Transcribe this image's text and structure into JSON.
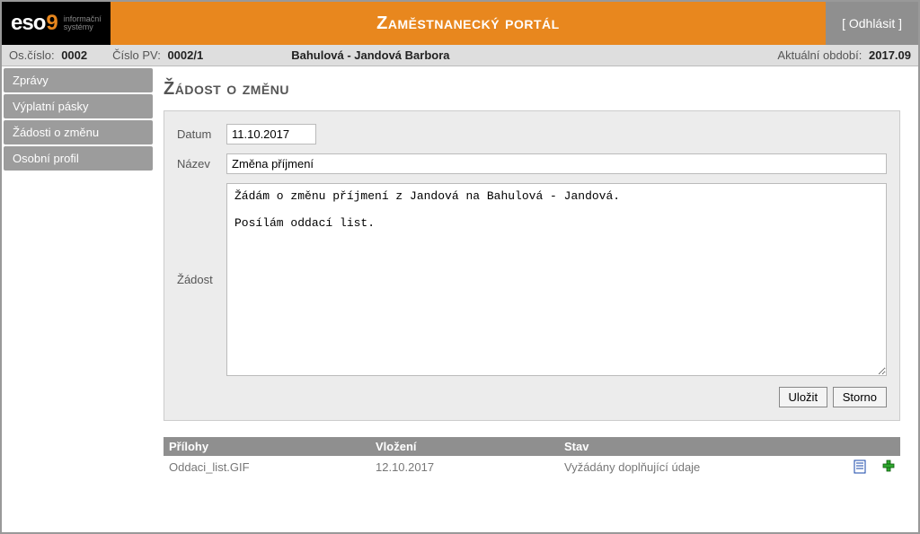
{
  "header": {
    "logo_main": "eso",
    "logo_accent": "9",
    "logo_sub1": "informační",
    "logo_sub2": "systémy",
    "title": "Zaměstnanecký portál",
    "logout": "[ Odhlásit ]"
  },
  "infobar": {
    "oscislo_label": "Os.číslo:",
    "oscislo_value": "0002",
    "cislopv_label": "Číslo PV:",
    "cislopv_value": "0002/1",
    "employee_name": "Bahulová - Jandová Barbora",
    "period_label": "Aktuální období:",
    "period_value": "2017.09"
  },
  "sidebar": {
    "items": [
      {
        "label": "Zprávy"
      },
      {
        "label": "Výplatní pásky"
      },
      {
        "label": "Žádosti o změnu"
      },
      {
        "label": "Osobní profil"
      }
    ]
  },
  "page": {
    "title": "Žádost o změnu"
  },
  "form": {
    "date_label": "Datum",
    "date_value": "11.10.2017",
    "name_label": "Název",
    "name_value": "Změna příjmení",
    "request_label": "Žádost",
    "request_text": "Žádám o změnu příjmení z Jandová na Bahulová - Jandová.\n\nPosílám oddací list.",
    "save_label": "Uložit",
    "cancel_label": "Storno"
  },
  "attachments": {
    "col_name": "Přílohy",
    "col_date": "Vložení",
    "col_status": "Stav",
    "rows": [
      {
        "name": "Oddaci_list.GIF",
        "date": "12.10.2017",
        "status": "Vyžádány doplňující údaje"
      }
    ]
  }
}
